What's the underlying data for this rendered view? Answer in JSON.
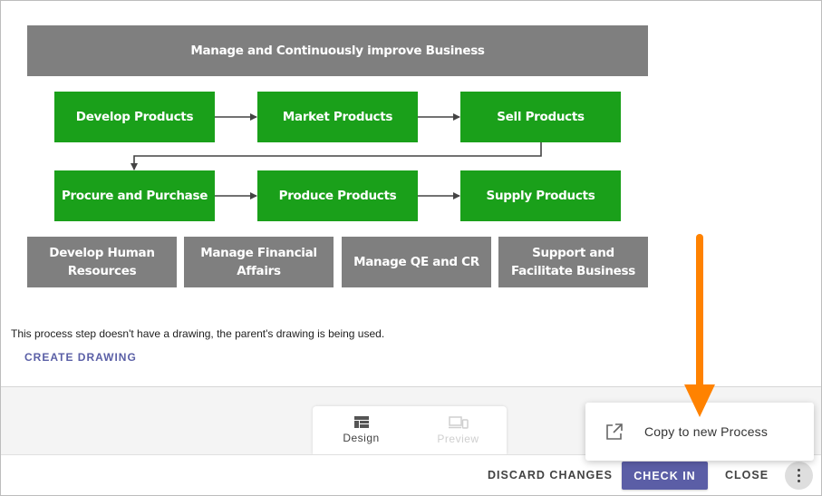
{
  "diagram": {
    "top_box": "Manage and Continuously improve Business",
    "row1": [
      "Develop Products",
      "Market Products",
      "Sell Products"
    ],
    "row2": [
      "Procure and Purchase",
      "Produce Products",
      "Supply Products"
    ],
    "support": [
      "Develop Human Resources",
      "Manage Financial Affairs",
      "Manage QE and CR",
      "Support and Facilitate Business"
    ],
    "colors": {
      "gray": "#7f7f7f",
      "green": "#1aa01a"
    }
  },
  "info": {
    "note": "This process step doesn't have a drawing, the parent's drawing is being used.",
    "create_drawing": "CREATE DRAWING"
  },
  "view_tabs": {
    "design": "Design",
    "preview": "Preview"
  },
  "popup_menu": {
    "copy_label": "Copy to new Process",
    "icon": "open-in-new-icon"
  },
  "bottom_bar": {
    "discard": "DISCARD CHANGES",
    "check_in": "CHECK IN",
    "close": "CLOSE",
    "more_icon": "more-vert-icon"
  },
  "annotation": {
    "arrow_color": "#ff8200"
  }
}
